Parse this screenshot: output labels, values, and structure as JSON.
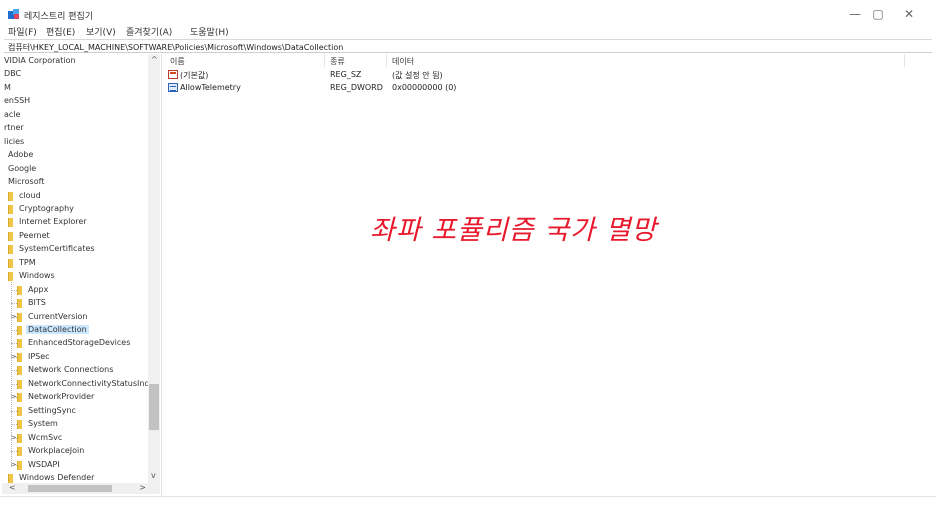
{
  "window": {
    "title": "레지스트리 편집기",
    "minimize": "—",
    "maximize": "▢",
    "close": "✕"
  },
  "menu": [
    "파일(F)",
    "편집(E)",
    "보기(V)",
    "즐겨찾기(A)",
    "도움말(H)"
  ],
  "address": "컴퓨터\\HKEY_LOCAL_MACHINE\\SOFTWARE\\Policies\\Microsoft\\Windows\\DataCollection",
  "tree": [
    {
      "label": "VIDIA Corporation",
      "indent": 0,
      "folder": false,
      "expander": ""
    },
    {
      "label": "DBC",
      "indent": 0,
      "folder": false,
      "expander": ""
    },
    {
      "label": "M",
      "indent": 0,
      "folder": false,
      "expander": ""
    },
    {
      "label": "enSSH",
      "indent": 0,
      "folder": false,
      "expander": ""
    },
    {
      "label": "acle",
      "indent": 0,
      "folder": false,
      "expander": ""
    },
    {
      "label": "rtner",
      "indent": 0,
      "folder": false,
      "expander": ""
    },
    {
      "label": "licies",
      "indent": 0,
      "folder": false,
      "expander": ""
    },
    {
      "label": "Adobe",
      "indent": 1,
      "folder": false,
      "expander": ""
    },
    {
      "label": "Google",
      "indent": 1,
      "folder": false,
      "expander": ""
    },
    {
      "label": "Microsoft",
      "indent": 1,
      "folder": false,
      "expander": ""
    },
    {
      "label": "cloud",
      "indent": 2,
      "folder": true,
      "expander": ""
    },
    {
      "label": "Cryptography",
      "indent": 2,
      "folder": true,
      "expander": ""
    },
    {
      "label": "Internet Explorer",
      "indent": 2,
      "folder": true,
      "expander": ""
    },
    {
      "label": "Peernet",
      "indent": 2,
      "folder": true,
      "expander": ""
    },
    {
      "label": "SystemCertificates",
      "indent": 2,
      "folder": true,
      "expander": ""
    },
    {
      "label": "TPM",
      "indent": 2,
      "folder": true,
      "expander": ""
    },
    {
      "label": "Windows",
      "indent": 2,
      "folder": true,
      "expander": ""
    },
    {
      "label": "Appx",
      "indent": 3,
      "folder": true,
      "expander": ""
    },
    {
      "label": "BITS",
      "indent": 3,
      "folder": true,
      "expander": ""
    },
    {
      "label": "CurrentVersion",
      "indent": 3,
      "folder": true,
      "expander": ">"
    },
    {
      "label": "DataCollection",
      "indent": 3,
      "folder": true,
      "expander": "",
      "selected": true
    },
    {
      "label": "EnhancedStorageDevices",
      "indent": 3,
      "folder": true,
      "expander": ""
    },
    {
      "label": "IPSec",
      "indent": 3,
      "folder": true,
      "expander": ">"
    },
    {
      "label": "Network Connections",
      "indent": 3,
      "folder": true,
      "expander": ""
    },
    {
      "label": "NetworkConnectivityStatusInd",
      "indent": 3,
      "folder": true,
      "expander": ""
    },
    {
      "label": "NetworkProvider",
      "indent": 3,
      "folder": true,
      "expander": ">"
    },
    {
      "label": "SettingSync",
      "indent": 3,
      "folder": true,
      "expander": ""
    },
    {
      "label": "System",
      "indent": 3,
      "folder": true,
      "expander": ""
    },
    {
      "label": "WcmSvc",
      "indent": 3,
      "folder": true,
      "expander": ">"
    },
    {
      "label": "WorkplaceJoin",
      "indent": 3,
      "folder": true,
      "expander": ""
    },
    {
      "label": "WSDAPI",
      "indent": 3,
      "folder": true,
      "expander": ">"
    },
    {
      "label": "Windows Defender",
      "indent": 2,
      "folder": true,
      "expander": ""
    }
  ],
  "scroll": {
    "up": "^",
    "down": "v",
    "left": "<",
    "right": ">"
  },
  "list": {
    "columns": [
      "이름",
      "종류",
      "데이터"
    ],
    "rows": [
      {
        "name": "(기본값)",
        "type": "REG_SZ",
        "data": "(값 설정 안 됨)",
        "icon": "string-value-icon"
      },
      {
        "name": "AllowTelemetry",
        "type": "REG_DWORD",
        "data": "0x00000000 (0)",
        "icon": "dword-value-icon"
      }
    ]
  },
  "overlay": "좌파 포퓰리즘 국가 멸망"
}
